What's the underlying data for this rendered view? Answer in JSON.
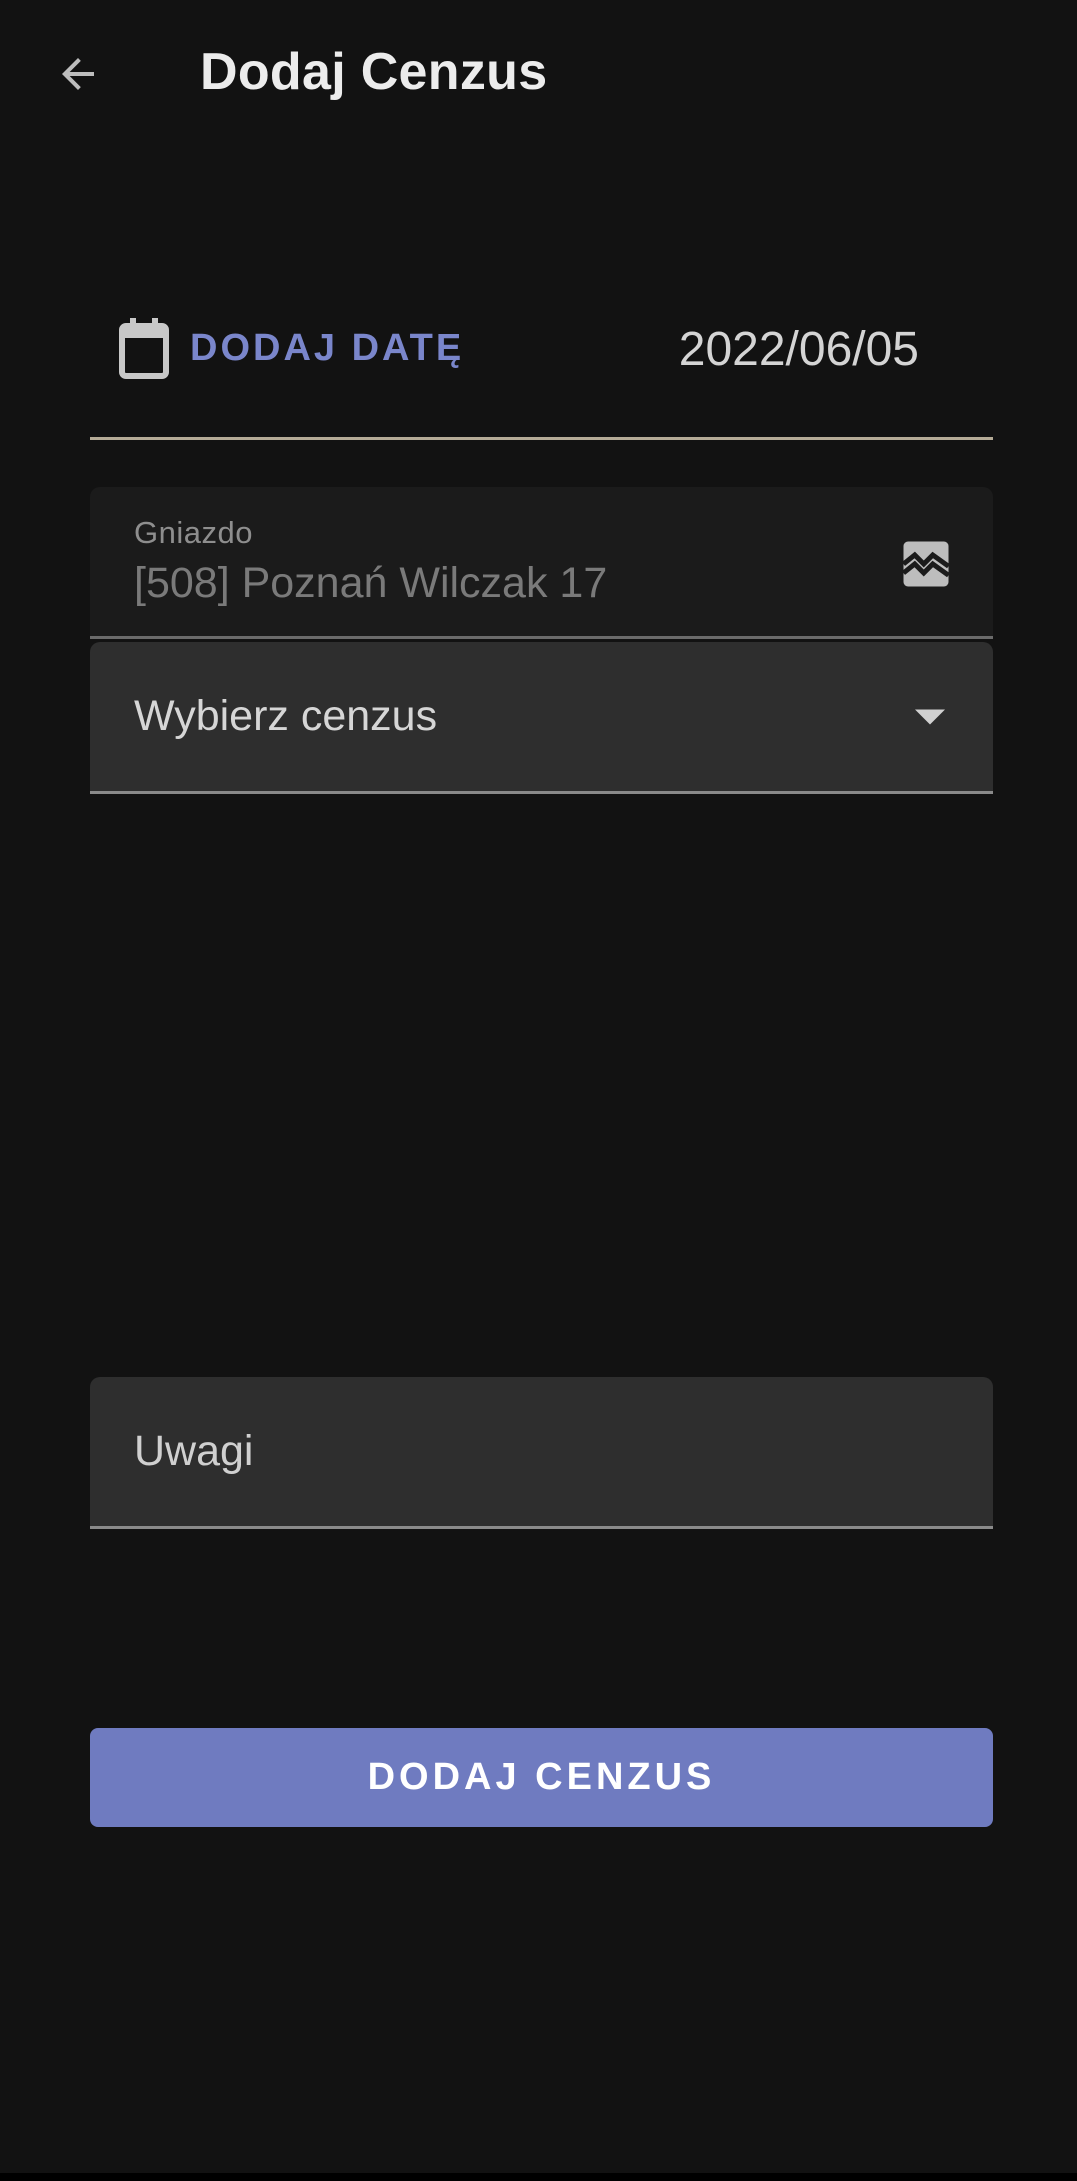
{
  "header": {
    "title": "Dodaj Cenzus",
    "back_icon": "arrow-left-icon"
  },
  "date": {
    "button_label": "DODAJ DATĘ",
    "button_icon": "calendar-icon",
    "value": "2022/06/05"
  },
  "nest": {
    "label": "Gniazdo",
    "value": "[508] Poznań Wilczak 17",
    "icon": "image-broken-icon"
  },
  "census_select": {
    "selected": "Wybierz cenzus",
    "icon": "dropdown-arrow-icon"
  },
  "notes": {
    "placeholder": "Uwagi"
  },
  "submit": {
    "label": "DODAJ CENZUS"
  },
  "colors": {
    "background": "#121212",
    "accent": "#7a86cb",
    "button": "#6f7bc0"
  }
}
